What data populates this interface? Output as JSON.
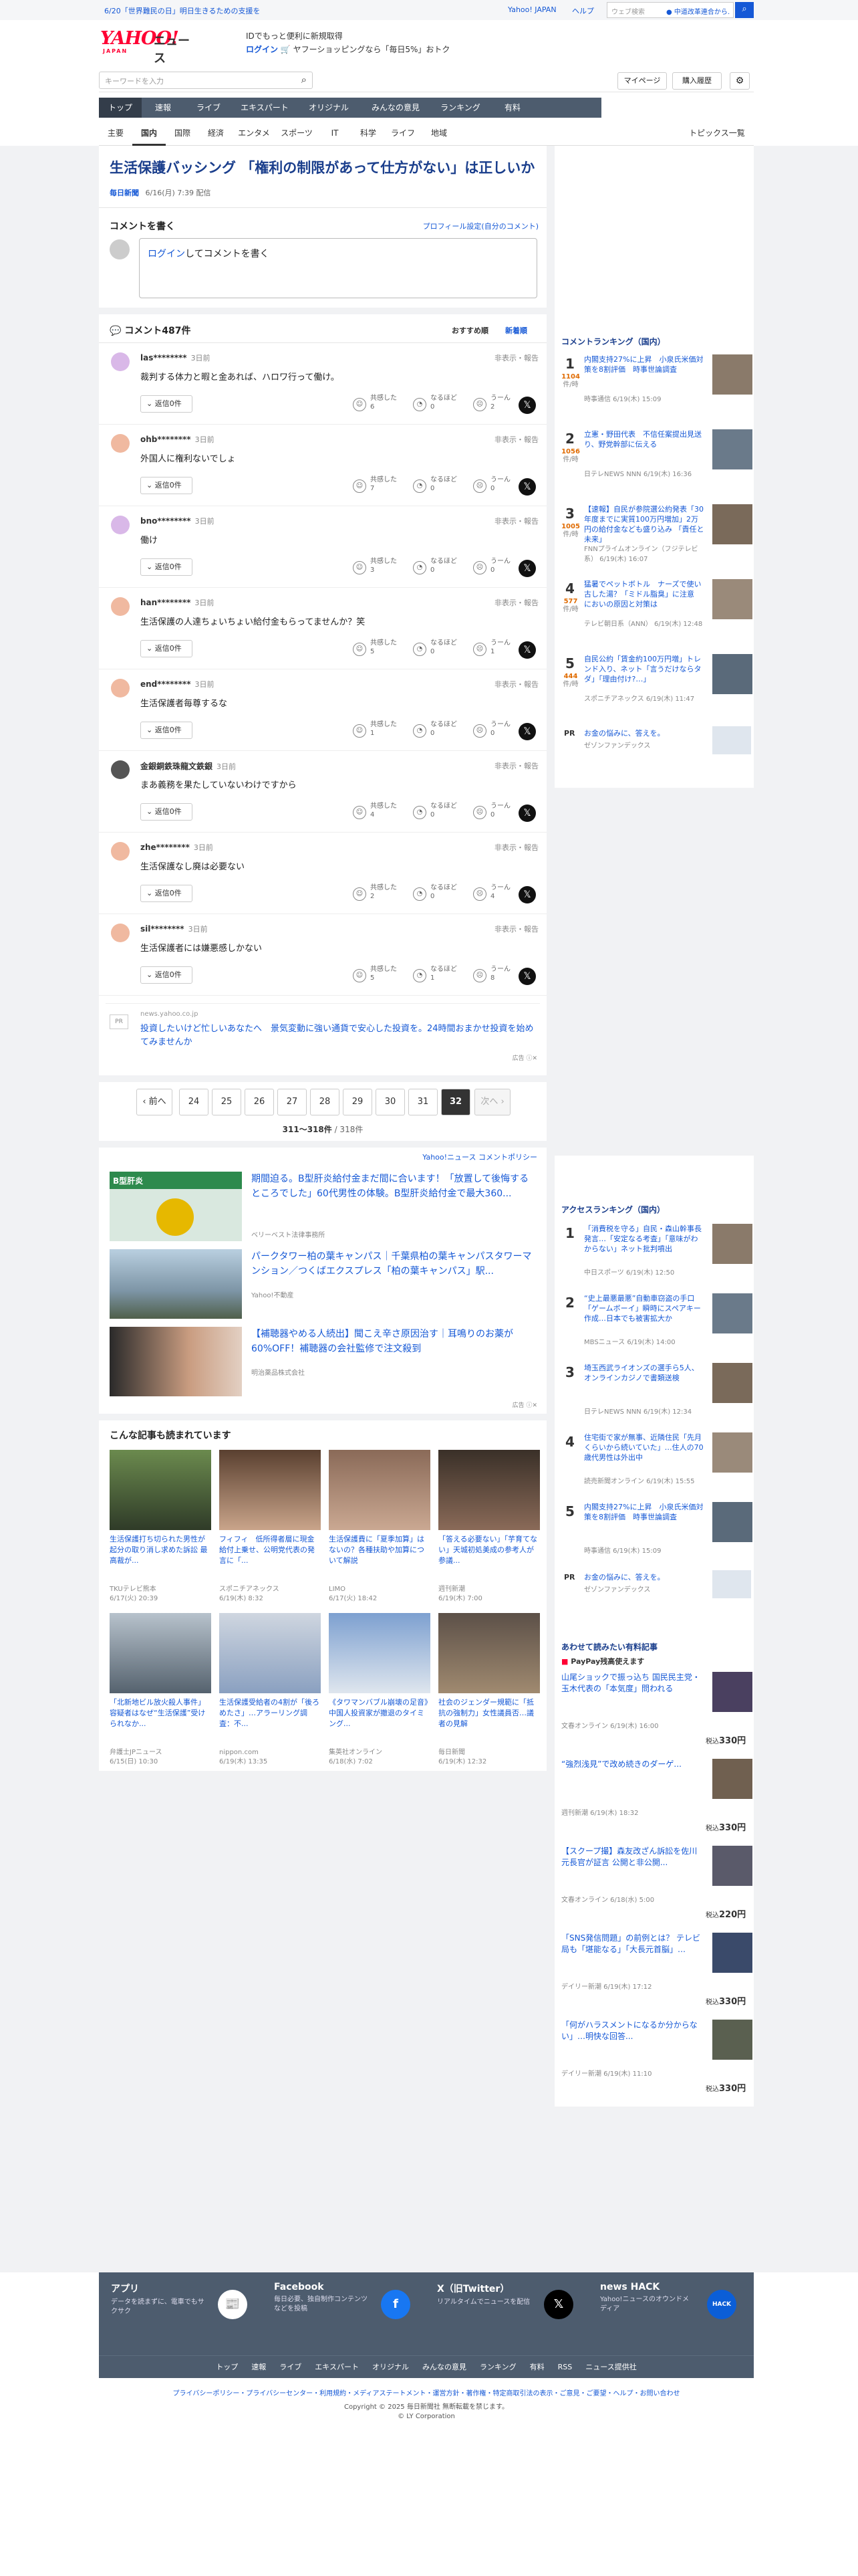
{
  "topbar": {
    "notice": "6/20「世界難民の日」明日生きるための支援を",
    "links": [
      "Yahoo! JAPAN",
      "ヘルプ"
    ],
    "search_placeholder": "ウェブ検索",
    "news_pill": "● 中道改革連合から…"
  },
  "header": {
    "logo": "YAHOO!",
    "logo_sub": "JAPAN",
    "news": "ニュース",
    "promo1": "IDでもっと便利に新規取得",
    "promo2_a": "ログイン",
    "promo2_b": "ヤフーショッピングなら「毎日5%」おトク",
    "mypage": "マイページ",
    "purchase": "購入履歴",
    "search_placeholder": "キーワードを入力"
  },
  "gnav": [
    "トップ",
    "速報",
    "ライブ",
    "エキスパート",
    "オリジナル",
    "みんなの意見",
    "ランキング",
    "有料"
  ],
  "subnav": [
    "主要",
    "国内",
    "国際",
    "経済",
    "エンタメ",
    "スポーツ",
    "IT",
    "科学",
    "ライフ",
    "地域"
  ],
  "subnav_right": "トピックス一覧",
  "article": {
    "title": "生活保護バッシング 「権利の制限があって仕方がない」は正しいか",
    "source": "毎日新聞",
    "date": "6/16(月) 7:39 配信"
  },
  "comment_write": {
    "heading": "コメントを書く",
    "profile_link": "プロフィール設定(自分のコメント)",
    "login": "ログイン",
    "prompt": "してコメントを書く"
  },
  "comments_header": {
    "count_label": "コメント487件",
    "sort_rec": "おすすめ順",
    "sort_new": "新着順"
  },
  "comment_ui": {
    "reply": "返信0件",
    "report": "非表示・報告",
    "l1": "共感した",
    "l2": "なるほど",
    "l3": "うーん"
  },
  "comments": [
    {
      "user": "las********",
      "time": "3日前",
      "text": "裁判する体力と暇と金あれば、ハロワ行って働け。",
      "c1": "6",
      "c2": "0",
      "c3": "2",
      "color": "#d9b8e8"
    },
    {
      "user": "ohb********",
      "time": "3日前",
      "text": "外国人に権利ないでしょ",
      "c1": "7",
      "c2": "0",
      "c3": "0",
      "color": "#f0b9a0"
    },
    {
      "user": "bno********",
      "time": "3日前",
      "text": "働け",
      "c1": "3",
      "c2": "0",
      "c3": "0",
      "color": "#d9b8e8"
    },
    {
      "user": "han********",
      "time": "3日前",
      "text": "生活保護の人達ちょいちょい給付金もらってませんか？笑",
      "c1": "5",
      "c2": "0",
      "c3": "1",
      "color": "#f0b9a0"
    },
    {
      "user": "end********",
      "time": "3日前",
      "text": "生活保護者毎尊するな",
      "c1": "1",
      "c2": "0",
      "c3": "0",
      "color": "#f0b9a0"
    },
    {
      "user": "金銀銅鉄珠龍文鉄銀",
      "time": "3日前",
      "text": "まあ義務を果たしていないわけですから",
      "c1": "4",
      "c2": "0",
      "c3": "0",
      "color": "#555555"
    },
    {
      "user": "zhe********",
      "time": "3日前",
      "text": "生活保護なし廃は必要ない",
      "c1": "2",
      "c2": "0",
      "c3": "4",
      "color": "#f0b9a0"
    },
    {
      "user": "sil********",
      "time": "3日前",
      "text": "生活保護者には嫌悪感しかない",
      "c1": "5",
      "c2": "1",
      "c3": "8",
      "color": "#f0b9a0"
    }
  ],
  "inline_ad": {
    "pr": "PR",
    "domain": "news.yahoo.co.jp",
    "text": "投資したいけど忙しいあなたへ　景気変動に強い通貨で安心した投資を。24時間おまかせ投資を始めてみませんか",
    "ad_label": "広告"
  },
  "pagination": {
    "prev": "‹ 前へ",
    "pages": [
      "24",
      "25",
      "26",
      "27",
      "28",
      "29",
      "30",
      "31",
      "32"
    ],
    "current": "32",
    "next": "次へ ›",
    "range": "311〜318件",
    "total": "/ 318件"
  },
  "policy": "Yahoo!ニュース コメントポリシー",
  "ads": [
    {
      "title": "期間迫る。B型肝炎給付金まだ間に合います！「放置して後悔するところでした」60代男性の体験。B型肝炎給付金で最大360...",
      "source": "ベリーベスト法律事務所",
      "img_text": "B型肝炎"
    },
    {
      "title": "パークタワー柏の葉キャンパス｜千葉県柏の葉キャンパスタワーマンション／つくばエクスプレス「柏の葉キャンパス」駅...",
      "source": "Yahoo!不動産"
    },
    {
      "title": "【補聴器やめる人続出】聞こえ辛さ原因治す｜耳鳴りのお薬が60%OFF！補聴器の会社監修で注文殺到",
      "source": "明治薬品株式会社"
    }
  ],
  "ad_label2": "広告",
  "also_read": {
    "heading": "こんな記事も読まれています",
    "items": [
      {
        "title": "生活保護打ち切られた男性が起分の取り消し求めた訴訟 最高裁が...",
        "src": "TKUテレビ熊本",
        "date": "6/17(火) 20:39"
      },
      {
        "title": "フィフィ　低所得者層に現金給付上乗せ、公明党代表の発言に「...",
        "src": "スポニチアネックス",
        "date": "6/19(木) 8:32"
      },
      {
        "title": "生活保護費に「夏季加算」はないの？各種扶助や加算について解説",
        "src": "LIMO",
        "date": "6/17(火) 18:42"
      },
      {
        "title": "「答える必要ない」「芋育てない」天城初処美成の参考人が参議...",
        "src": "週刊新潮",
        "date": "6/19(木) 7:00"
      },
      {
        "title": "「北新地ビル放火殺人事件」容疑者はなぜ“生活保護”受けられなか...",
        "src": "弁護士JPニュース",
        "date": "6/15(日) 10:30"
      },
      {
        "title": "生活保護受給者の4割が「後ろめたさ」…アラーリング調査：不...",
        "src": "nippon.com",
        "date": "6/19(木) 13:35"
      },
      {
        "title": "《タワマンバブル崩壊の足音》中国人投資家が撤退のタイミング...",
        "src": "集英社オンライン",
        "date": "6/18(水) 7:02"
      },
      {
        "title": "社会のジェンダー規範に「抵抗の強制力」女性議員否…議者の見解",
        "src": "毎日新聞",
        "date": "6/19(木) 12:32"
      }
    ]
  },
  "ranking": {
    "heading": "コメントランキング（国内）",
    "unit": "件/時",
    "items": [
      {
        "n": "1",
        "score": "1104",
        "title": "内閣支持27%に上昇　小泉氏米価対策を8割評価　時事世論調査",
        "meta": "時事通信 6/19(木) 15:09"
      },
      {
        "n": "2",
        "score": "1056",
        "title": "立憲・野田代表　不信任案提出見送り、野党幹部に伝える",
        "meta": "日テレNEWS NNN 6/19(木) 16:36"
      },
      {
        "n": "3",
        "score": "1005",
        "title": "【速報】自民が参院選公約発表「30年度までに実質100万円増加」2万円の給付金なども盛り込み 「責任と未来」",
        "meta": "FNNプライムオンライン（フジテレビ系） 6/19(木) 16:07"
      },
      {
        "n": "4",
        "score": "577",
        "title": "猛暑でペットボトル　ナーズで使い古した湯？「ミドル脂臭」に注意　においの原因と対策は",
        "meta": "テレビ朝日系（ANN） 6/19(木) 12:48"
      },
      {
        "n": "5",
        "score": "444",
        "title": "自民公約「賃金約100万円増」トレンド入り、ネット「言うだけならタダ」「理由付け?…」",
        "meta": "スポニチアネックス 6/19(木) 11:47"
      }
    ],
    "pr_title": "お金の悩みに、答えを。",
    "pr_src": "ゼゾンファンデックス"
  },
  "access_ranking": {
    "heading": "アクセスランキング（国内）",
    "items": [
      {
        "n": "1",
        "title": "「消費税を守る」自民・森山幹事長発言…「安定なる考査」「意味がわからない」ネット批判噴出",
        "meta": "中日スポーツ 6/19(木) 12:50"
      },
      {
        "n": "2",
        "title": "“史上最悪最悪”自動車窃盗の手口「ゲームボーイ」瞬時にスペアキー作成…日本でも被害拡大か",
        "meta": "MBSニュース 6/19(木) 14:00"
      },
      {
        "n": "3",
        "title": "埼玉西武ライオンズの選手ら5人、オンラインカジノで書類送検",
        "meta": "日テレNEWS NNN 6/19(木) 12:34"
      },
      {
        "n": "4",
        "title": "住宅街で家が無事、近隣住民「先月くらいから続いていた」…住人の70歳代男性は外出中",
        "meta": "読売新聞オンライン 6/19(木) 15:55"
      },
      {
        "n": "5",
        "title": "内閣支持27%に上昇　小泉氏米価対策を8割評価　時事世論調査",
        "meta": "時事通信 6/19(木) 15:09"
      }
    ],
    "pr_title": "お金の悩みに、答えを。",
    "pr_src": "ゼゾンファンデックス"
  },
  "paid": {
    "heading": "あわせて読みたい有料記事",
    "paypay": "PayPay残高使えます",
    "price_prefix": "税込",
    "items": [
      {
        "title": "山尾ショックで振っ込ち 国民民主党・玉木代表の「本気度」問われる",
        "src": "文春オンライン 6/19(木) 16:00",
        "price": "330円"
      },
      {
        "title": "“強烈浅見”で改め続きのダーゲ...",
        "src": "週刊新潮 6/19(木) 18:32",
        "price": "330円"
      },
      {
        "title": "【スクープ撮】森友改ざん訴訟を佐川元長官が証言 公開と非公開...",
        "src": "文春オンライン 6/18(水) 5:00",
        "price": "220円"
      },
      {
        "title": "「SNS発信問題」の前例とは？ テレビ局も「堪能なる」「大長元首脳」…",
        "src": "デイリー新潮 6/19(木) 17:12",
        "price": "330円"
      },
      {
        "title": "「何がハラスメントになるか分からない」…明快な回答...",
        "src": "デイリー新潮 6/19(木) 11:10",
        "price": "330円"
      }
    ]
  },
  "footer": {
    "cols": [
      {
        "title": "アプリ",
        "desc": "データを読まずに、電車でもサクサク"
      },
      {
        "title": "Facebook",
        "desc": "毎日必要、独自制作コンテンツなどを投稿"
      },
      {
        "title": "X（旧Twitter）",
        "desc": "リアルタイムでニュースを配信"
      },
      {
        "title": "news HACK",
        "desc": "Yahoo!ニュースのオウンドメディア"
      }
    ],
    "links": [
      "トップ",
      "速報",
      "ライブ",
      "エキスパート",
      "オリジナル",
      "みんなの意見",
      "ランキング",
      "有料",
      "RSS",
      "ニュース提供社"
    ],
    "legal": "プライバシーポリシー・プライバシーセンター・利用規約・メディアステートメント・運営方針・著作権・特定商取引法の表示・ご意見・ご要望・ヘルプ・お問い合わせ",
    "copyright": "Copyright © 2025 毎日新聞社 無断転載を禁じます。",
    "corp": "© LY Corporation"
  }
}
